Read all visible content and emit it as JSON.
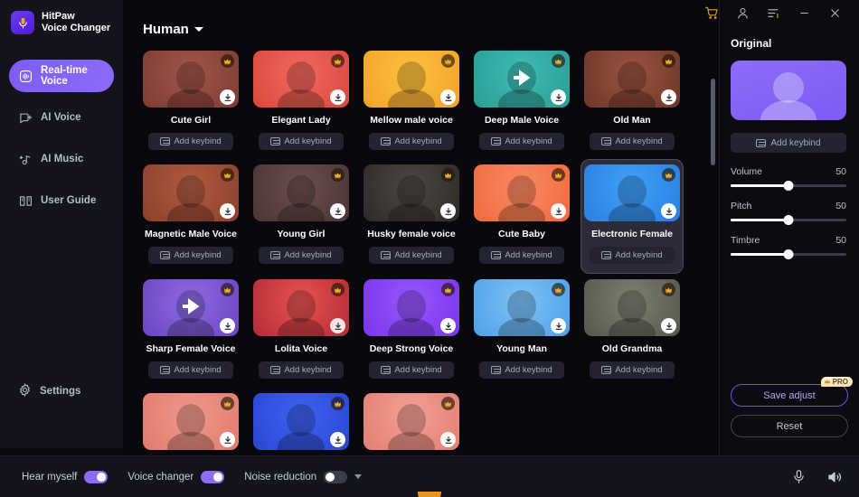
{
  "titlebar": {
    "buttons": [
      {
        "name": "cart-icon",
        "label": "Cart"
      },
      {
        "name": "account-icon",
        "label": "Account"
      },
      {
        "name": "menu-icon",
        "label": "Menu"
      },
      {
        "name": "minimize-icon",
        "label": "Minimize"
      },
      {
        "name": "close-icon",
        "label": "Close"
      }
    ]
  },
  "sidebar": {
    "brand_line1": "HitPaw",
    "brand_line2": "Voice Changer",
    "items": [
      {
        "label": "Real-time Voice",
        "icon": "waveform-icon",
        "active": true
      },
      {
        "label": "AI Voice",
        "icon": "ai-voice-icon",
        "active": false
      },
      {
        "label": "AI Music",
        "icon": "music-note-icon",
        "active": false
      },
      {
        "label": "User Guide",
        "icon": "book-icon",
        "active": false
      }
    ],
    "settings_label": "Settings",
    "settings_icon": "gear-icon"
  },
  "main": {
    "category_label": "Human",
    "category_icon": "chevron-down-icon",
    "keybind_label": "Add keybind",
    "cards": [
      {
        "title": "Cute Girl",
        "bg1": "#a0564a",
        "bg2": "#7d3c33",
        "selected": false,
        "arrow": false,
        "dl_tint": "#ffffff"
      },
      {
        "title": "Elegant Lady",
        "bg1": "#f2695f",
        "bg2": "#d9483f",
        "selected": false,
        "arrow": false,
        "dl_tint": "#ffffff"
      },
      {
        "title": "Mellow male voice",
        "bg1": "#fcc23f",
        "bg2": "#f2a227",
        "selected": false,
        "arrow": false,
        "dl_tint": "#ffffff"
      },
      {
        "title": "Deep Male Voice",
        "bg1": "#3fbdb4",
        "bg2": "#2a9d95",
        "selected": false,
        "arrow": true,
        "dl_tint": "#ffffff"
      },
      {
        "title": "Old Man",
        "bg1": "#9a5440",
        "bg2": "#6d3628",
        "selected": false,
        "arrow": false,
        "dl_tint": "#ffffff"
      },
      {
        "title": "Magnetic Male Voice",
        "bg1": "#b05c3f",
        "bg2": "#8a3f2b",
        "selected": false,
        "arrow": false,
        "dl_tint": "#ffffff"
      },
      {
        "title": "Young Girl",
        "bg1": "#6c5050",
        "bg2": "#4a3434",
        "selected": false,
        "arrow": false,
        "dl_tint": "#ffffff"
      },
      {
        "title": "Husky female voice",
        "bg1": "#4c4744",
        "bg2": "#2e2a28",
        "selected": false,
        "arrow": false,
        "dl_tint": "#ffffff"
      },
      {
        "title": "Cute Baby",
        "bg1": "#fa8a63",
        "bg2": "#ef6a3d",
        "selected": false,
        "arrow": false,
        "dl_tint": "#ffffff"
      },
      {
        "title": "Electronic Female",
        "bg1": "#3ea2f5",
        "bg2": "#2b7ee0",
        "selected": true,
        "arrow": false,
        "dl_tint": "#ffffff"
      },
      {
        "title": "Sharp Female Voice",
        "bg1": "#8d6ae0",
        "bg2": "#6a45c4",
        "selected": false,
        "arrow": true,
        "dl_tint": "#ffffff"
      },
      {
        "title": "Lolita Voice",
        "bg1": "#e8544f",
        "bg2": "#b32a38",
        "selected": false,
        "arrow": false,
        "dl_tint": "#ffe4e4"
      },
      {
        "title": "Deep Strong Voice",
        "bg1": "#9557fb",
        "bg2": "#7a35ee",
        "selected": false,
        "arrow": false,
        "dl_tint": "#ffffff"
      },
      {
        "title": "Young Man",
        "bg1": "#7fc4f5",
        "bg2": "#4e9fe8",
        "selected": false,
        "arrow": false,
        "dl_tint": "#ffffff"
      },
      {
        "title": "Old Grandma",
        "bg1": "#7f7f72",
        "bg2": "#55554b",
        "selected": false,
        "arrow": false,
        "dl_tint": "#ffffff"
      },
      {
        "title": "",
        "bg1": "#f09a8d",
        "bg2": "#e07a6c",
        "selected": false,
        "arrow": false,
        "dl_tint": "#ffffff"
      },
      {
        "title": "",
        "bg1": "#3d62f0",
        "bg2": "#2a46d2",
        "selected": false,
        "arrow": false,
        "dl_tint": "#ffffff"
      },
      {
        "title": "",
        "bg1": "#f3a196",
        "bg2": "#e27f72",
        "selected": false,
        "arrow": false,
        "dl_tint": "#ffffff"
      }
    ]
  },
  "right_panel": {
    "title": "Original",
    "keybind_label": "Add keybind",
    "sliders": [
      {
        "name": "Volume",
        "value": "50",
        "percent": 50
      },
      {
        "name": "Pitch",
        "value": "50",
        "percent": 50
      },
      {
        "name": "Timbre",
        "value": "50",
        "percent": 50
      }
    ],
    "save_label": "Save adjust",
    "pro_label": "PRO",
    "reset_label": "Reset"
  },
  "bottombar": {
    "toggles": [
      {
        "label": "Hear myself",
        "on": true
      },
      {
        "label": "Voice changer",
        "on": true
      },
      {
        "label": "Noise reduction",
        "on": false
      }
    ],
    "mic_icon": "microphone-icon",
    "speaker_icon": "speaker-icon"
  },
  "colors": {
    "accent": "#8b6df8",
    "sidebar_bg": "#14141c",
    "main_bg": "#09090d",
    "gold": "#e0a325"
  }
}
